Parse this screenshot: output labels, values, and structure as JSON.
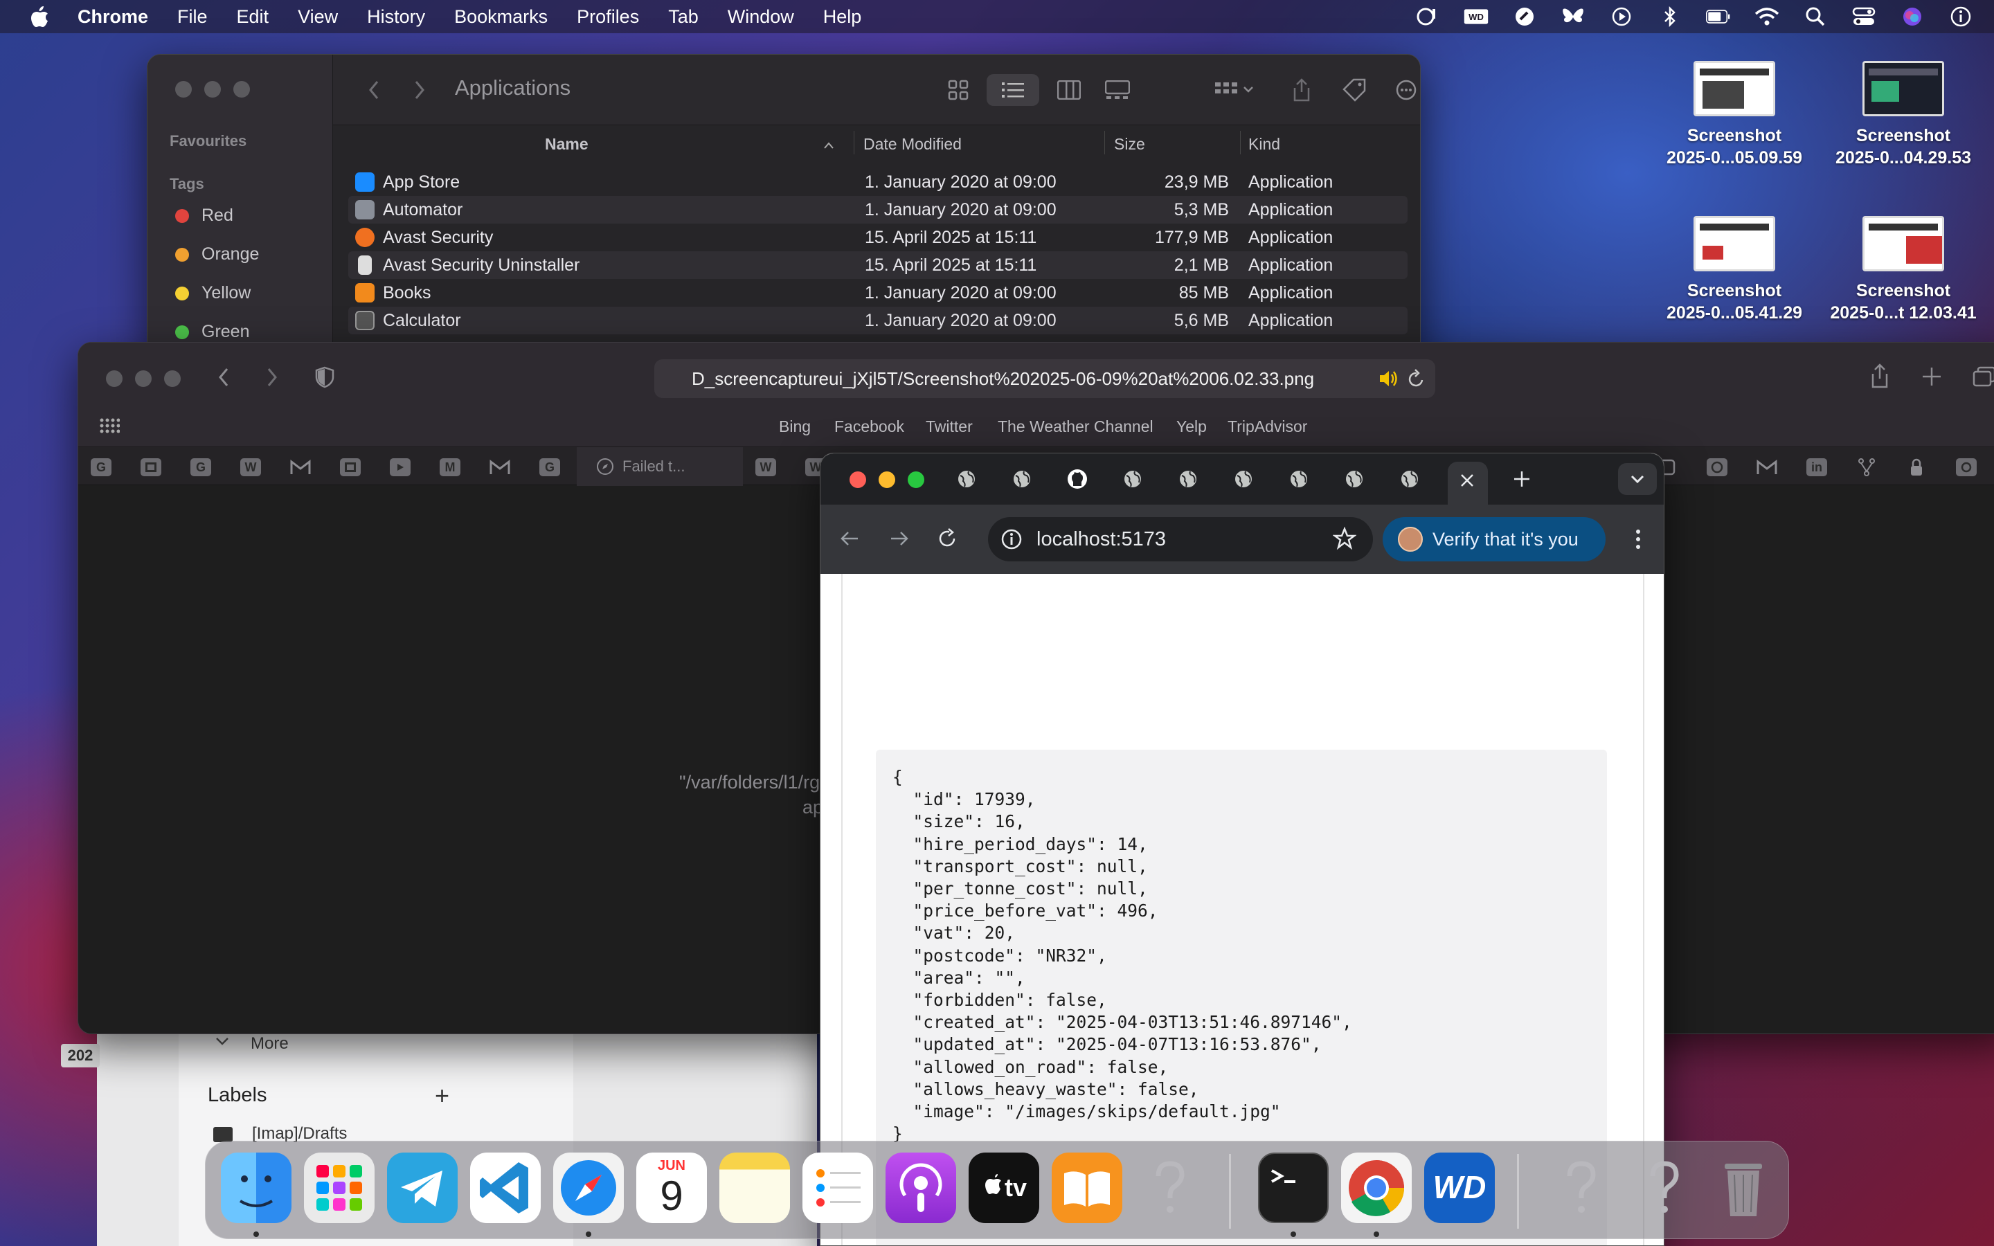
{
  "menubar": {
    "app_name": "Chrome",
    "items": [
      "File",
      "Edit",
      "View",
      "History",
      "Bookmarks",
      "Profiles",
      "Tab",
      "Window",
      "Help"
    ]
  },
  "desktop": {
    "icons": [
      {
        "line1": "Screenshot",
        "line2": "2025-0...05.09.59"
      },
      {
        "line1": "Screenshot",
        "line2": "2025-0...04.29.53"
      },
      {
        "line1": "Screenshot",
        "line2": "2025-0...05.41.29"
      },
      {
        "line1": "Screenshot",
        "line2": "2025-0...t 12.03.41"
      }
    ]
  },
  "finder": {
    "title": "Applications",
    "sidebar": {
      "favourites": "Favourites",
      "tags_heading": "Tags",
      "tags": [
        {
          "label": "Red",
          "color": "#e0443e"
        },
        {
          "label": "Orange",
          "color": "#f0a030"
        },
        {
          "label": "Yellow",
          "color": "#f5d033"
        },
        {
          "label": "Green",
          "color": "#4cc24a"
        }
      ]
    },
    "columns": {
      "name": "Name",
      "date": "Date Modified",
      "size": "Size",
      "kind": "Kind"
    },
    "rows": [
      {
        "name": "App Store",
        "date": "1. January 2020 at 09:00",
        "size": "23,9 MB",
        "kind": "Application",
        "icon_color": "#1a8cff"
      },
      {
        "name": "Automator",
        "date": "1. January 2020 at 09:00",
        "size": "5,3 MB",
        "kind": "Application",
        "icon_color": "#8a8f99"
      },
      {
        "name": "Avast Security",
        "date": "15. April 2025 at 15:11",
        "size": "177,9 MB",
        "kind": "Application",
        "icon_color": "#f07020"
      },
      {
        "name": "Avast Security Uninstaller",
        "date": "15. April 2025 at 15:11",
        "size": "2,1 MB",
        "kind": "Application",
        "icon_color": "#dddddd"
      },
      {
        "name": "Books",
        "date": "1. January 2020 at 09:00",
        "size": "85 MB",
        "kind": "Application",
        "icon_color": "#f28a1c"
      },
      {
        "name": "Calculator",
        "date": "1. January 2020 at 09:00",
        "size": "5,6 MB",
        "kind": "Application",
        "icon_color": "#555555"
      }
    ]
  },
  "safari": {
    "url": "D_screencaptureui_jXjl5T/Screenshot%202025-06-09%20at%2006.02.33.png",
    "favorites": [
      "Bing",
      "Facebook",
      "Twitter",
      "The Weather Channel",
      "Yelp",
      "TripAdvisor"
    ],
    "tab_letters": [
      "G",
      "",
      "G",
      "W",
      "M",
      "",
      "",
      "M",
      "M",
      "G"
    ],
    "failed_tab": "Failed t...",
    "message_line1": "\"/var/folders/l1/rg",
    "message_line2": "ap"
  },
  "gmail": {
    "more": "More",
    "labels": "Labels",
    "draft_label": "[Imap]/Drafts",
    "year_tag": "202"
  },
  "chrome": {
    "address": "localhost:5173",
    "verify": "Verify that it's you",
    "json_text": "{\n  \"id\": 17939,\n  \"size\": 16,\n  \"hire_period_days\": 14,\n  \"transport_cost\": null,\n  \"per_tonne_cost\": null,\n  \"price_before_vat\": 496,\n  \"vat\": 20,\n  \"postcode\": \"NR32\",\n  \"area\": \"\",\n  \"forbidden\": false,\n  \"created_at\": \"2025-04-03T13:51:46.897146\",\n  \"updated_at\": \"2025-04-07T13:16:53.876\",\n  \"allowed_on_road\": false,\n  \"allows_heavy_waste\": false,\n  \"image\": \"/images/skips/default.jpg\"\n}"
  },
  "dock": {
    "calendar_month": "JUN",
    "calendar_day": "9",
    "tv_label": "tv"
  }
}
